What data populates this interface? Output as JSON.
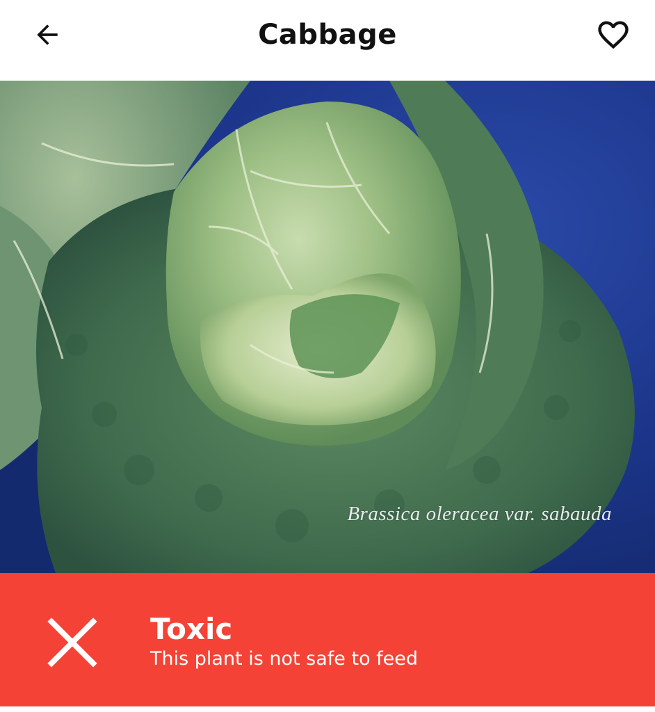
{
  "header": {
    "title": "Cabbage",
    "back_icon": "arrow-left-icon",
    "favorite_icon": "heart-outline-icon"
  },
  "photo": {
    "caption": "Brassica oleracea var. sabauda"
  },
  "status": {
    "title": "Toxic",
    "subtitle": "This plant is not safe to feed",
    "icon": "close-x-icon",
    "color": "#f44336"
  },
  "colors": {
    "background": "#ffffff",
    "title_text": "#111111",
    "banner": "#f44336",
    "banner_text": "#ffffff"
  }
}
